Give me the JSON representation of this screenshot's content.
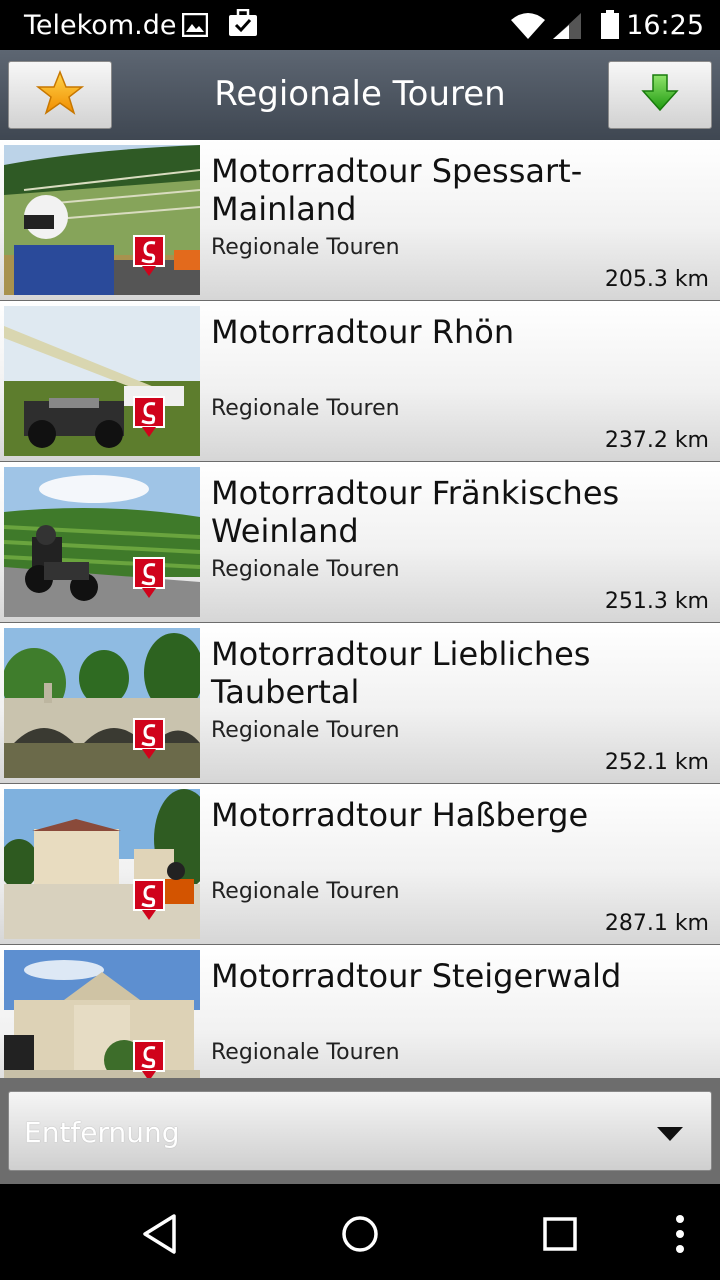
{
  "status_bar": {
    "carrier": "Telekom.de",
    "time": "16:25",
    "icons": [
      "image-icon",
      "briefcase-check-icon",
      "wifi-icon",
      "signal-icon",
      "battery-icon"
    ]
  },
  "action_bar": {
    "title": "Regionale Touren",
    "favorites_icon": "star-icon",
    "download_icon": "download-arrow-icon"
  },
  "tours": [
    {
      "title": "Motorradtour Spessart-Mainland",
      "category": "Regionale Touren",
      "distance": "205.3 km"
    },
    {
      "title": "Motorradtour Rhön",
      "category": "Regionale Touren",
      "distance": "237.2 km"
    },
    {
      "title": "Motorradtour Fränkisches Weinland",
      "category": "Regionale Touren",
      "distance": "251.3 km"
    },
    {
      "title": "Motorradtour Liebliches Taubertal",
      "category": "Regionale Touren",
      "distance": "252.1 km"
    },
    {
      "title": "Motorradtour Haßberge",
      "category": "Regionale Touren",
      "distance": "287.1 km"
    },
    {
      "title": "Motorradtour Steigerwald",
      "category": "Regionale Touren",
      "distance": ""
    }
  ],
  "sort": {
    "selected": "Entfernung"
  },
  "colors": {
    "actionbar": "#4c5560",
    "badge_red": "#d0021b",
    "download_green": "#3cb521",
    "star_orange": "#f5a623"
  },
  "nav_bar": {
    "icons": [
      "back-icon",
      "home-icon",
      "recents-icon",
      "overflow-menu-icon"
    ]
  }
}
